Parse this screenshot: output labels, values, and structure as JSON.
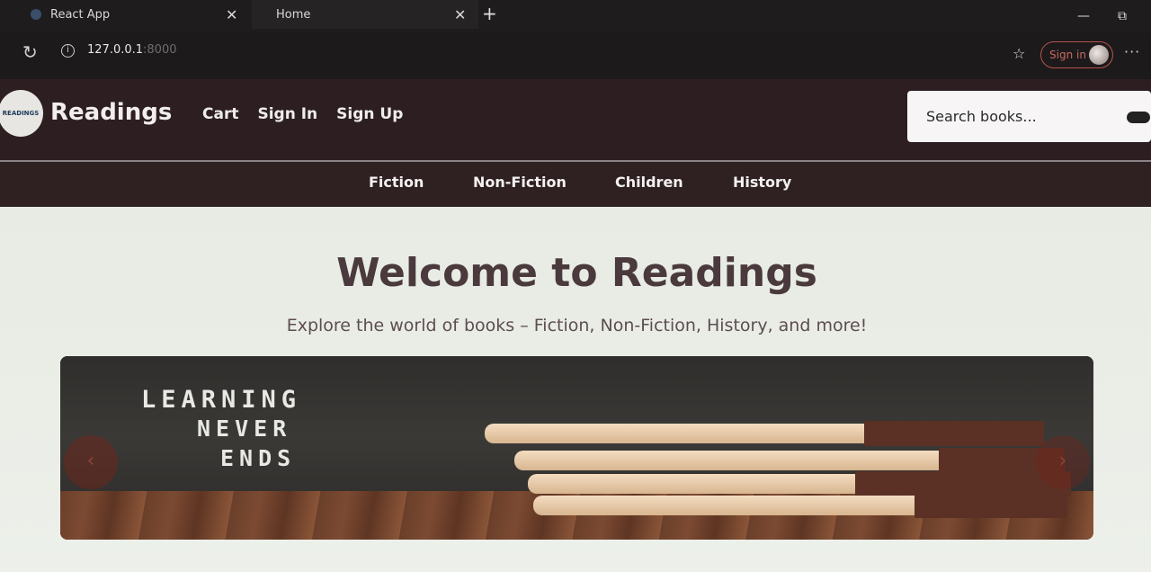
{
  "browser": {
    "tabs": [
      {
        "title": "React App"
      },
      {
        "title": "Home"
      }
    ],
    "address": {
      "host": "127.0.0.1",
      "port": ":8000"
    },
    "signin_label": "Sign in"
  },
  "header": {
    "logo_text": "READINGS",
    "brand": "Readings",
    "nav": [
      "Cart",
      "Sign In",
      "Sign Up"
    ],
    "search_placeholder": "Search books..."
  },
  "categories": [
    "Fiction",
    "Non-Fiction",
    "Children",
    "History"
  ],
  "hero": {
    "title": "Welcome to Readings",
    "subtitle": "Explore the world of books – Fiction, Non-Fiction, History, and more!",
    "banner_lines": [
      "LEARNING",
      "NEVER",
      "ENDS"
    ],
    "prev_icon": "‹",
    "next_icon": "›"
  },
  "colors": {
    "header_bg": "#2d1f21",
    "hero_text": "#4a3a3d",
    "page_bg": "#e9ece6"
  }
}
